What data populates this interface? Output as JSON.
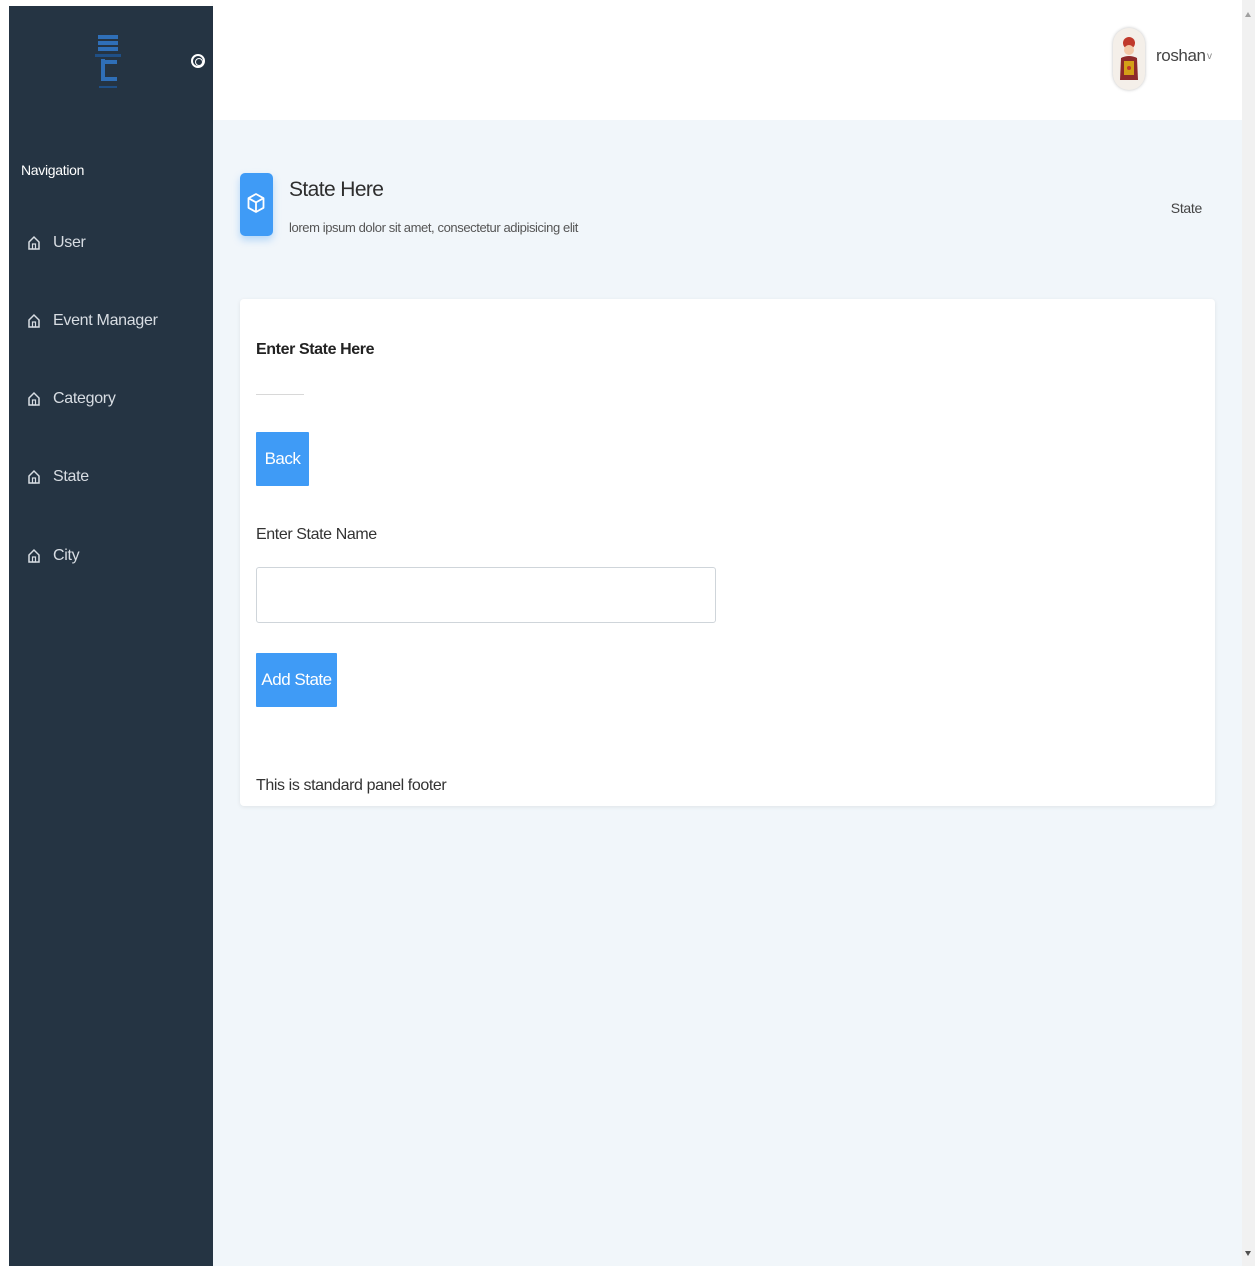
{
  "sidebar": {
    "heading": "Navigation",
    "items": [
      {
        "label": "User",
        "icon": "home-icon"
      },
      {
        "label": "Event Manager",
        "icon": "home-icon"
      },
      {
        "label": "Category",
        "icon": "home-icon"
      },
      {
        "label": "State",
        "icon": "home-icon"
      },
      {
        "label": "City",
        "icon": "home-icon"
      }
    ]
  },
  "header": {
    "user_name": "roshan",
    "user_menu_chevron": "v"
  },
  "page": {
    "title": "State Here",
    "subtitle": "lorem ipsum dolor sit amet, consectetur adipisicing elit",
    "breadcrumb": "State"
  },
  "panel": {
    "title": "Enter State Here",
    "back_label": "Back",
    "field_label": "Enter State Name",
    "field_value": "",
    "submit_label": "Add State",
    "footer": "This is standard panel footer"
  },
  "colors": {
    "sidebar_bg": "#253443",
    "accent": "#3f9bf6",
    "content_bg": "#f1f6fa"
  }
}
